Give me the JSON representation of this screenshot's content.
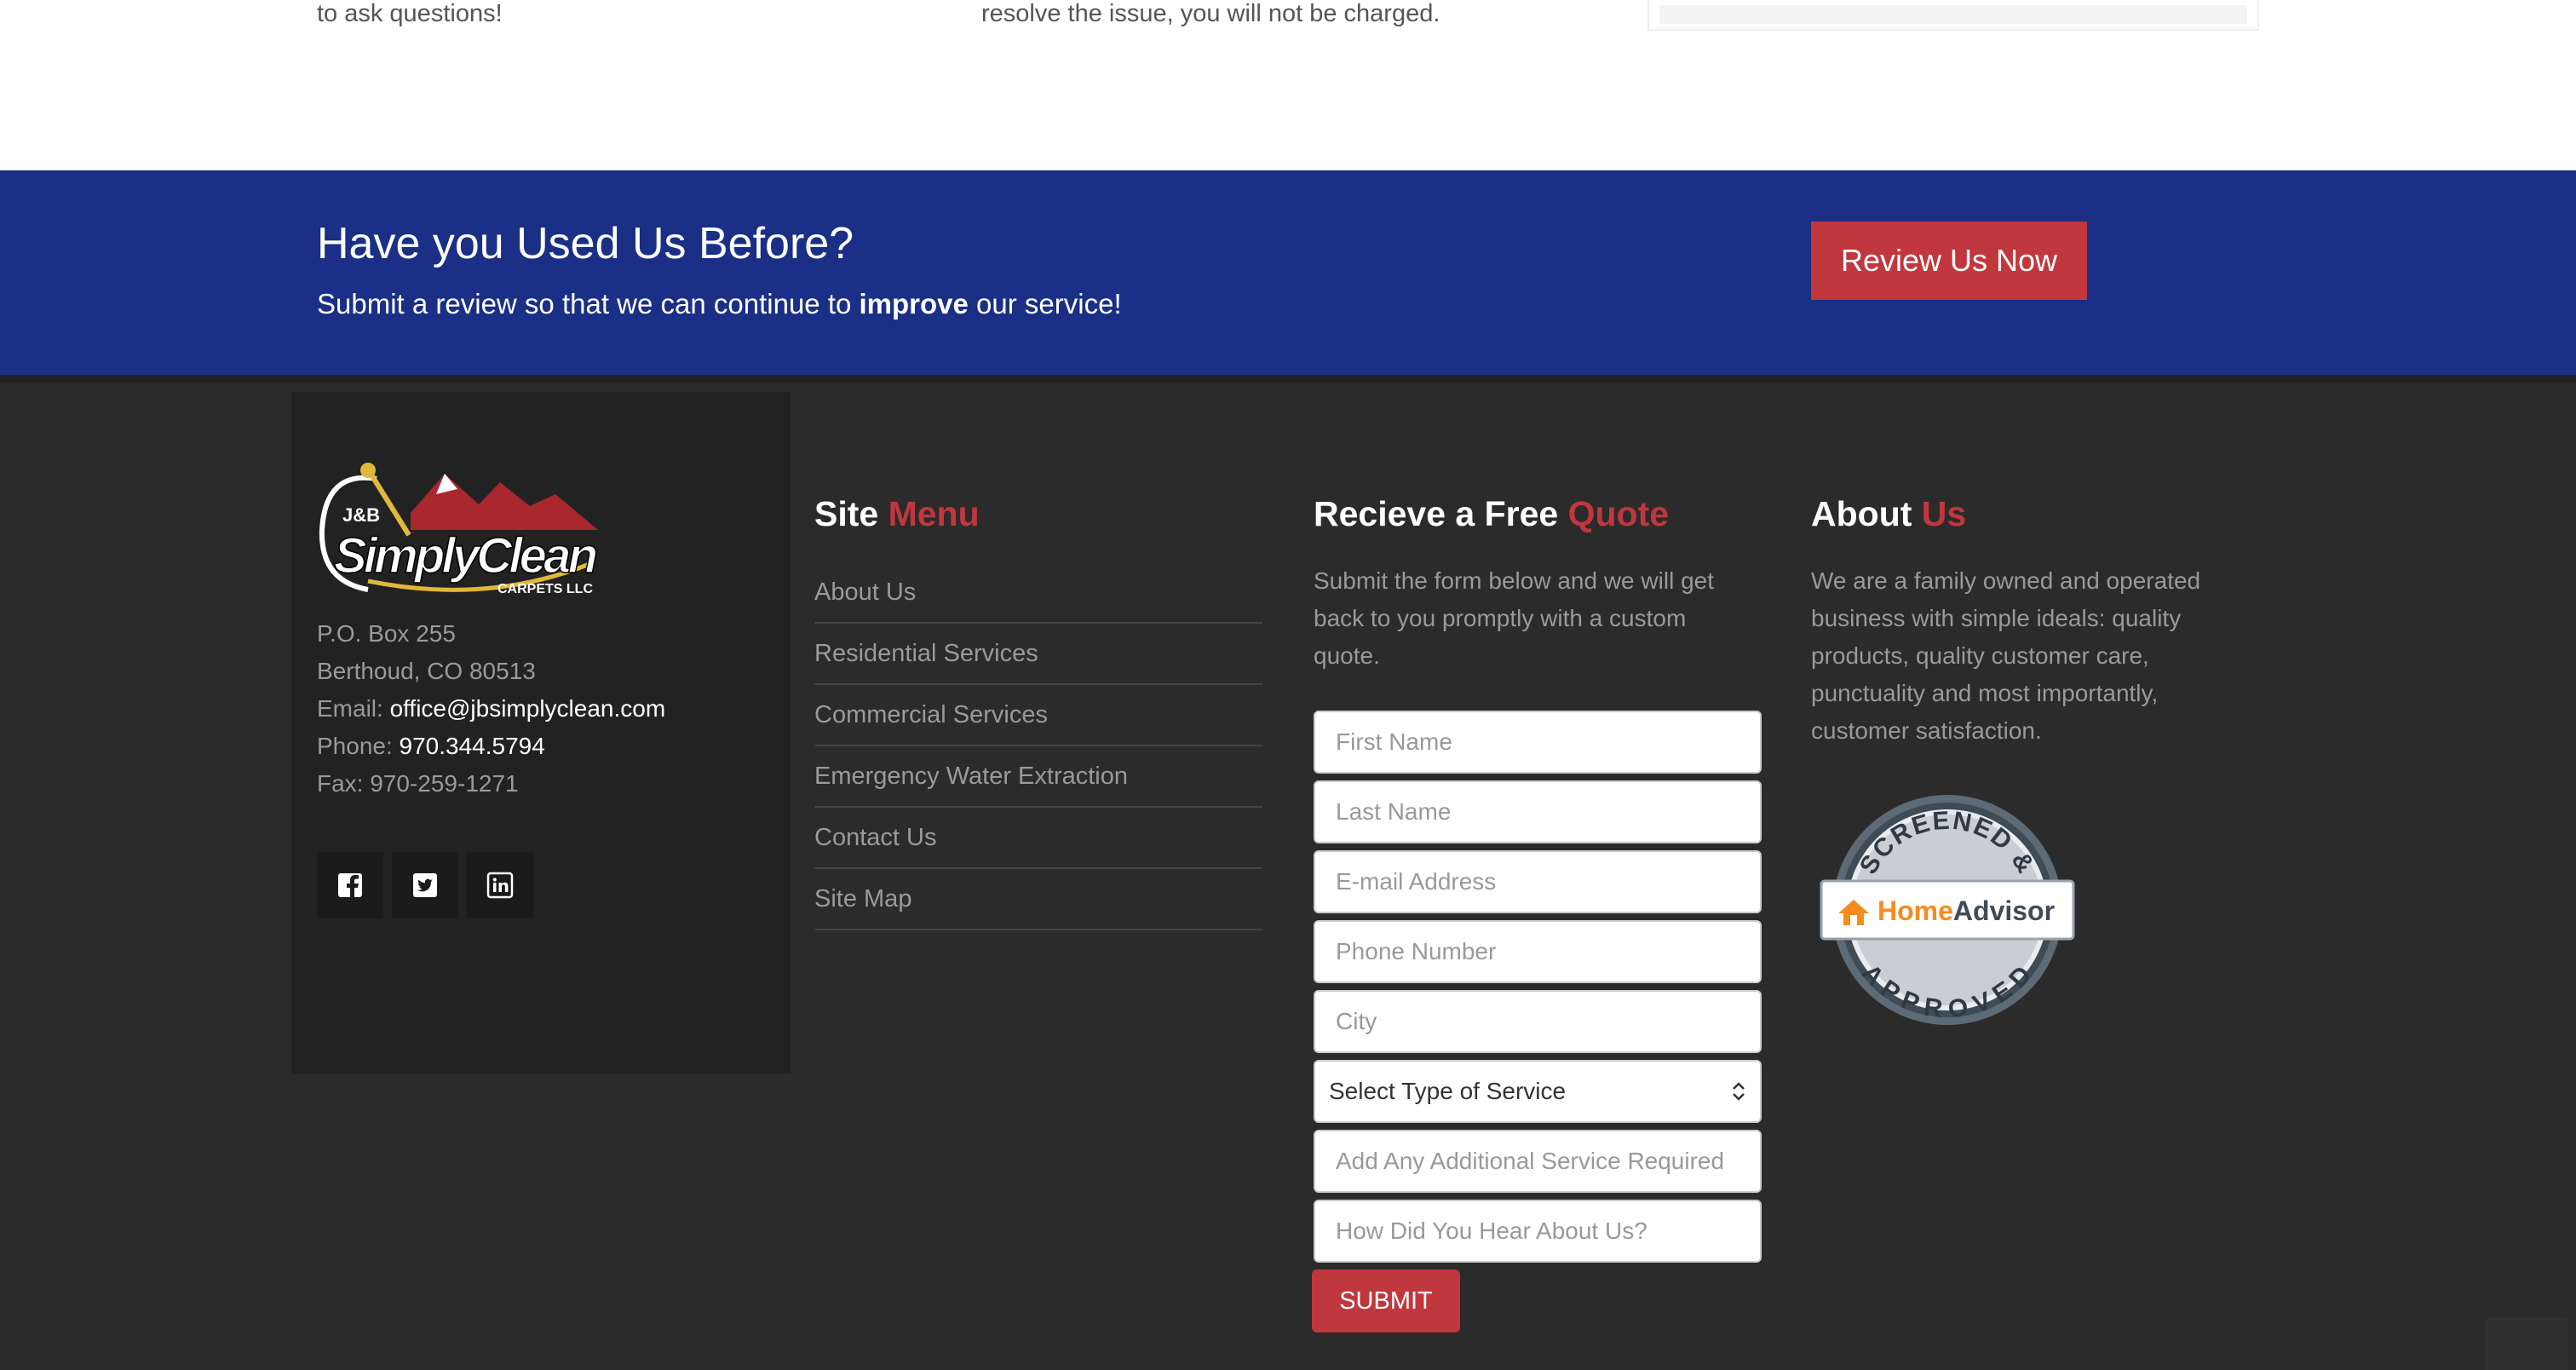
{
  "top": {
    "left_text": "to ask questions!",
    "mid_text": "resolve the issue, you will not be charged."
  },
  "banner": {
    "title": "Have you Used Us Before?",
    "subtitle_before": "Submit a review so that we can continue to ",
    "subtitle_bold": "improve",
    "subtitle_after": " our service!",
    "button_label": "Review Us Now"
  },
  "company": {
    "logo_text_small": "J&B",
    "logo_text_main": "SimplyClean",
    "logo_text_sub": "CARPETS LLC",
    "address_line1": "P.O. Box 255",
    "address_line2": "Berthoud, CO 80513",
    "email_label": "Email: ",
    "email": "office@jbsimplyclean.com",
    "phone_label": "Phone: ",
    "phone": "970.344.5794",
    "fax": "Fax: 970-259-1271",
    "social": [
      {
        "icon": "facebook-icon"
      },
      {
        "icon": "twitter-icon"
      },
      {
        "icon": "linkedin-icon"
      }
    ]
  },
  "site_menu": {
    "title_plain": "Site ",
    "title_accent": "Menu",
    "items": [
      "About Us",
      "Residential Services",
      "Commercial Services",
      "Emergency Water Extraction",
      "Contact Us",
      "Site Map"
    ]
  },
  "quote": {
    "title_plain": "Recieve a Free ",
    "title_accent": "Quote",
    "description": "Submit the form below and we will get back to you promptly with a custom quote.",
    "fields": {
      "first_name": "First Name",
      "last_name": "Last Name",
      "email": "E-mail Address",
      "phone": "Phone Number",
      "city": "City",
      "service_select": "Select Type of Service",
      "additional": "Add Any Additional Service Required",
      "heard": "How Did You Hear About Us?"
    },
    "submit_label": "SUBMIT"
  },
  "about": {
    "title_plain": "About ",
    "title_accent": "Us",
    "description": "We are a family owned and operated business with simple ideals: quality products, quality customer care, punctuality and most importantly, customer satisfaction.",
    "badge_top": "SCREENED &",
    "badge_brand_a": "Home",
    "badge_brand_b": "Advisor",
    "badge_bottom": "APPROVED"
  },
  "colors": {
    "banner_blue": "#1a2f85",
    "accent_red": "#c0373d",
    "footer_bg": "#2b2b2b",
    "homeadvisor_orange": "#f68b1f"
  }
}
